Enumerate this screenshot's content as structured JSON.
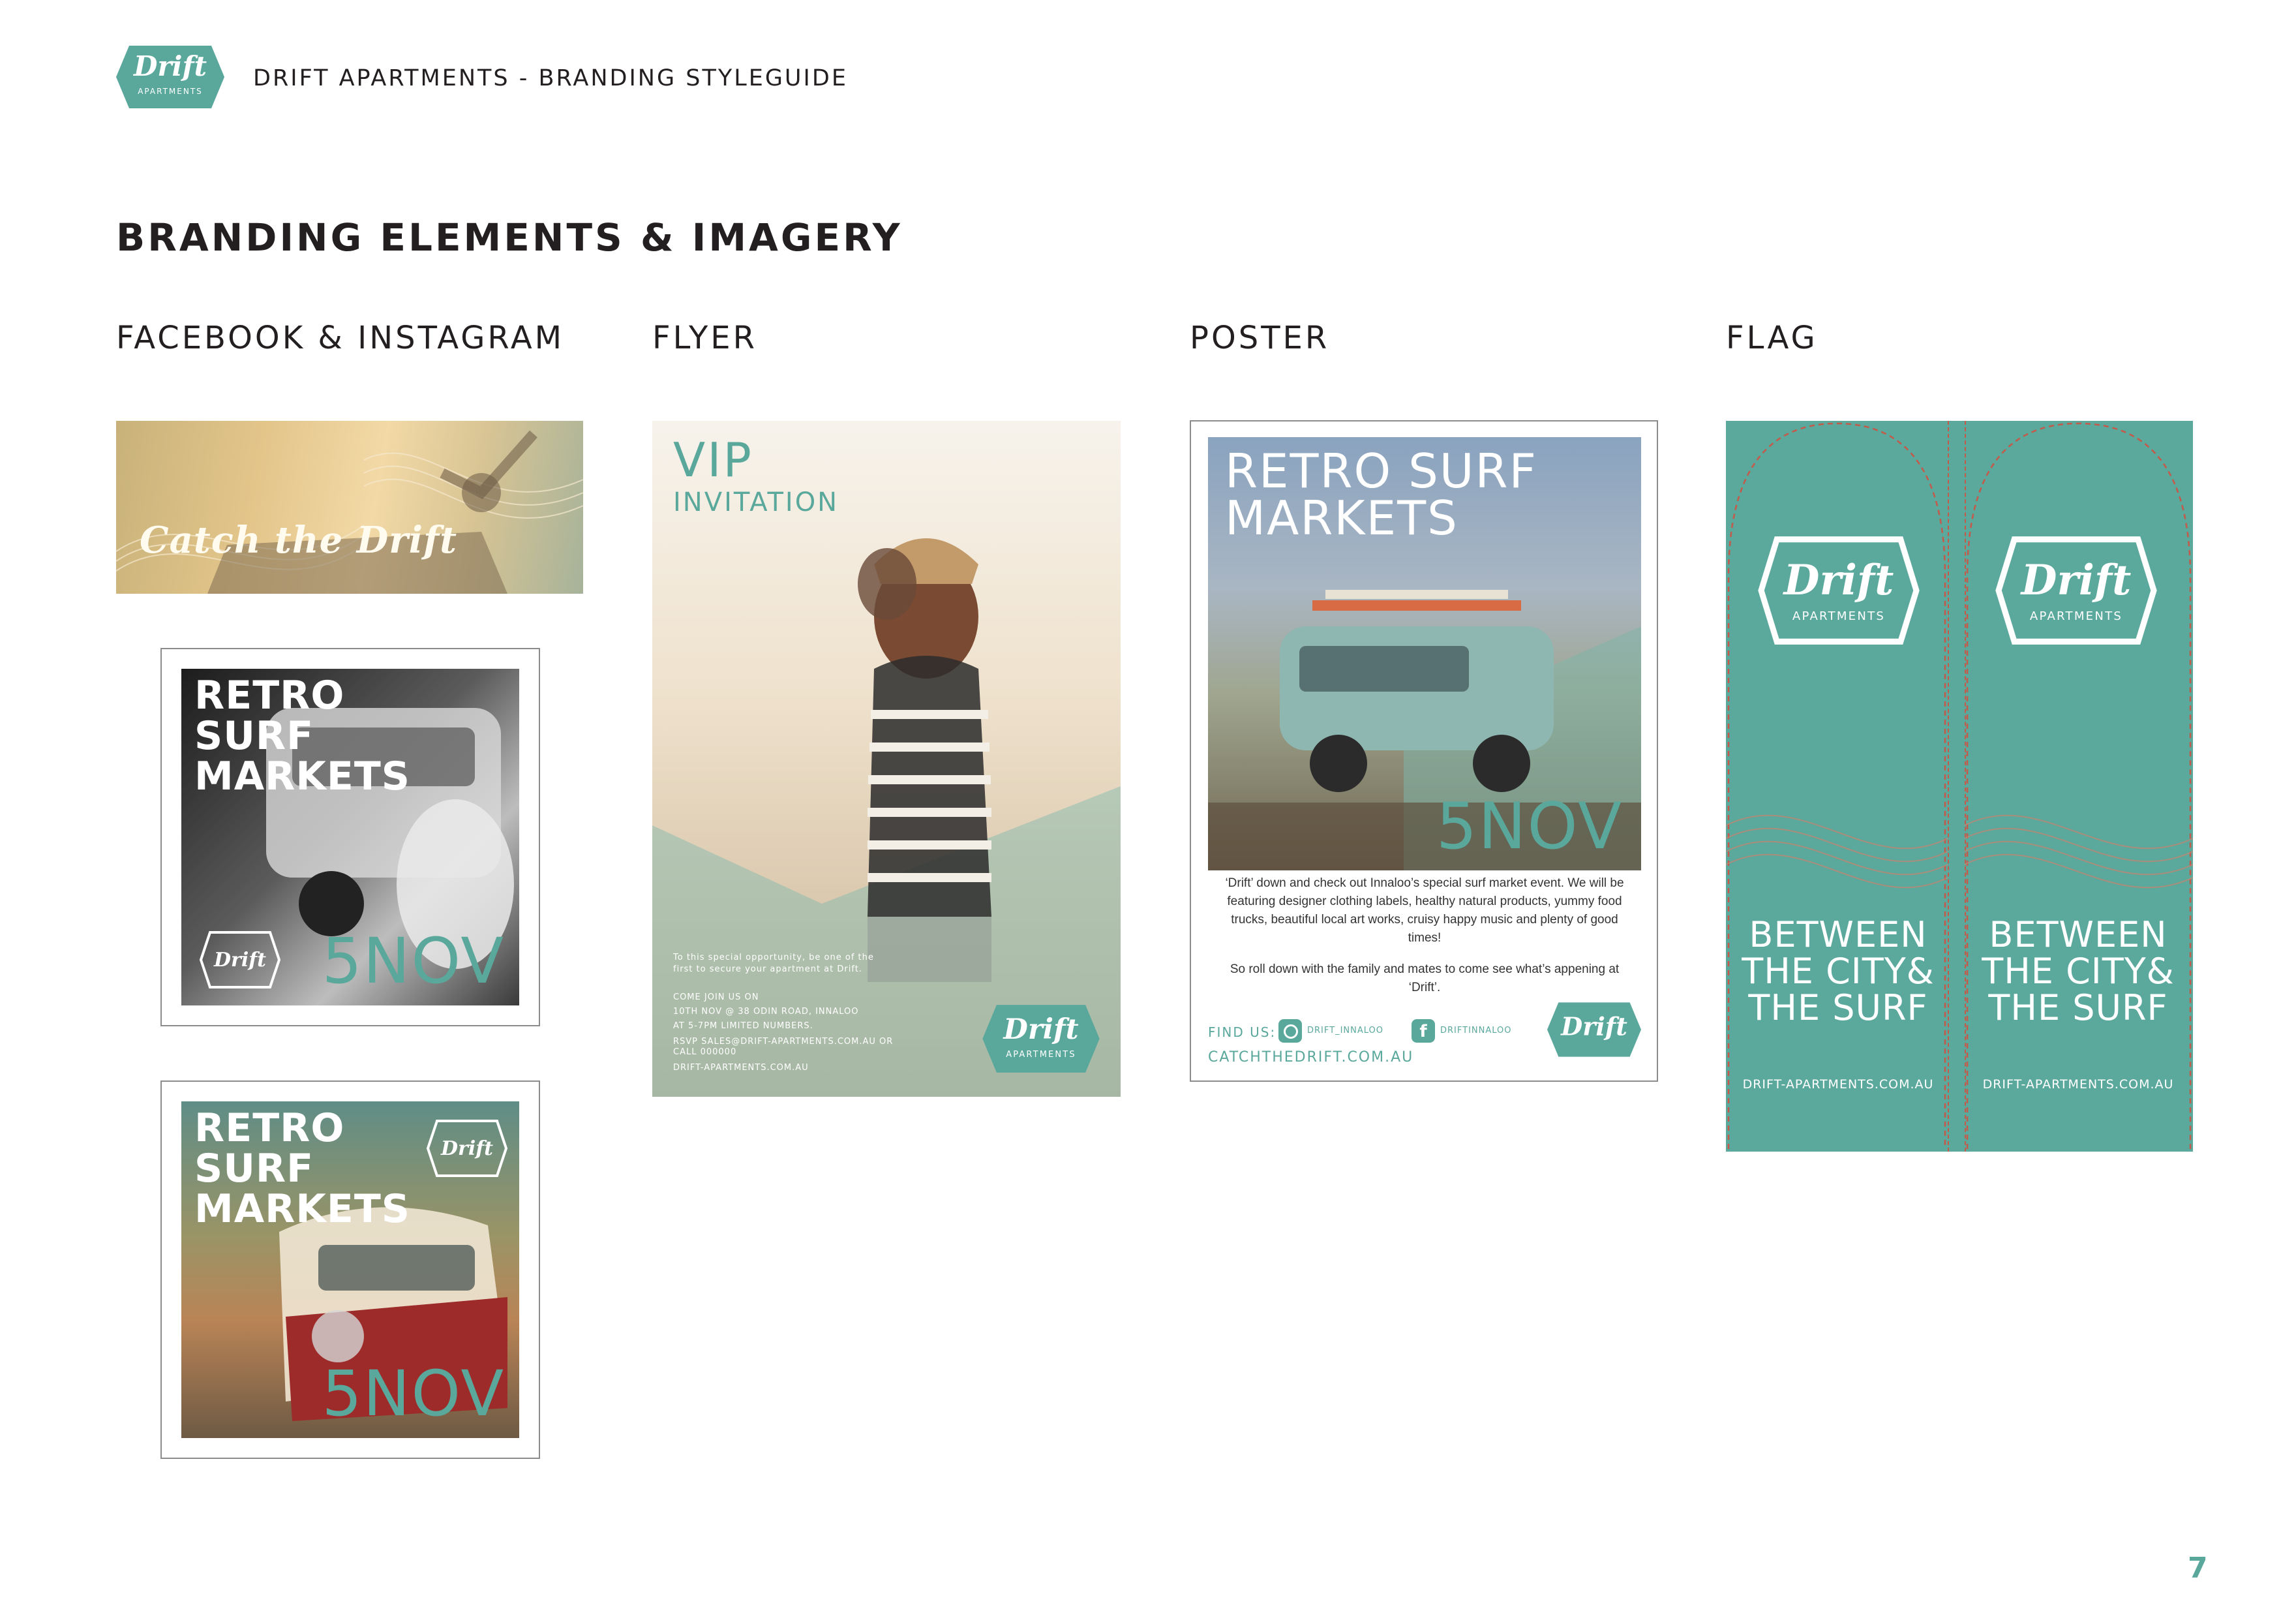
{
  "header": {
    "logo_word": "Drift",
    "logo_sub": "APARTMENTS",
    "title": "DRIFT APARTMENTS - BRANDING STYLEGUIDE"
  },
  "section_title": "BRANDING ELEMENTS & IMAGERY",
  "columns": {
    "social": "FACEBOOK & INSTAGRAM",
    "flyer": "FLYER",
    "poster": "POSTER",
    "flag": "FLAG"
  },
  "social": {
    "banner_script": "Catch the Drift",
    "tile1": {
      "line1": "RETRO",
      "line2": "SURF",
      "line3": "MARKETS",
      "logo": "Drift",
      "date": "5NOV"
    },
    "tile2": {
      "line1": "RETRO",
      "line2": "SURF",
      "line3": "MARKETS",
      "logo": "Drift",
      "date": "5NOV"
    }
  },
  "flyer": {
    "vip": "VIP",
    "invitation": "INVITATION",
    "intro": "To this special opportunity, be one of the first to secure your apartment at Drift.",
    "come": "COME JOIN US ON",
    "date_line": "10TH NOV @ 38 ODIN ROAD, INNALOO",
    "time_line": "AT 5-7PM LIMITED NUMBERS.",
    "rsvp": "RSVP SALES@DRIFT-APARTMENTS.COM.AU OR",
    "call": "CALL 000000",
    "web": "DRIFT-APARTMENTS.COM.AU",
    "logo_word": "Drift",
    "logo_sub": "APARTMENTS"
  },
  "poster": {
    "line1": "RETRO SURF",
    "line2": "MARKETS",
    "date": "5NOV",
    "para1": "‘Drift’ down and check out Innaloo’s special surf market event. We will be featuring designer clothing labels, healthy natural products, yummy food trucks, beautiful local art works, cruisy happy music and plenty of good times!",
    "para2": "So roll down with the family and mates to come see what’s appening at ‘Drift’.",
    "find_us": "FIND US:",
    "instagram": "DRIFT_INNALOO",
    "facebook": "DRIFTINNALOO",
    "web": "CATCHTHEDRIFT.COM.AU",
    "logo": "Drift"
  },
  "flag": {
    "logo_word": "Drift",
    "logo_sub": "APARTMENTS",
    "l1": "BETWEEN",
    "l2": "THE CITY&",
    "l3": "THE SURF",
    "url": "DRIFT-APARTMENTS.COM.AU"
  },
  "page_number": "7",
  "colors": {
    "brand_teal": "#5aa89c",
    "dashed_red": "#c45a4a",
    "text_dark": "#231f20"
  }
}
